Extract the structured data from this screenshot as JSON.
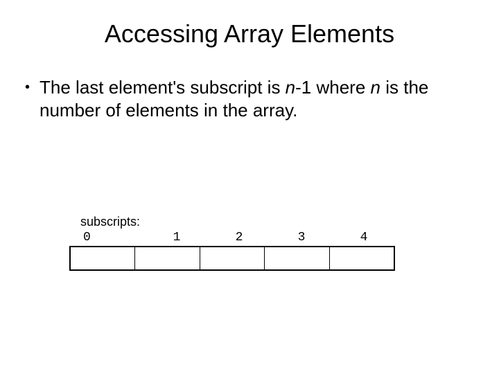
{
  "title": "Accessing Array Elements",
  "bullet": {
    "part1": "The last element's subscript is ",
    "n1": "n",
    "part2": "-1 where ",
    "n2": "n",
    "part3": " is the number of elements in the array."
  },
  "diagram": {
    "label": "subscripts:",
    "indices": [
      "0",
      "1",
      "2",
      "3",
      "4"
    ]
  }
}
